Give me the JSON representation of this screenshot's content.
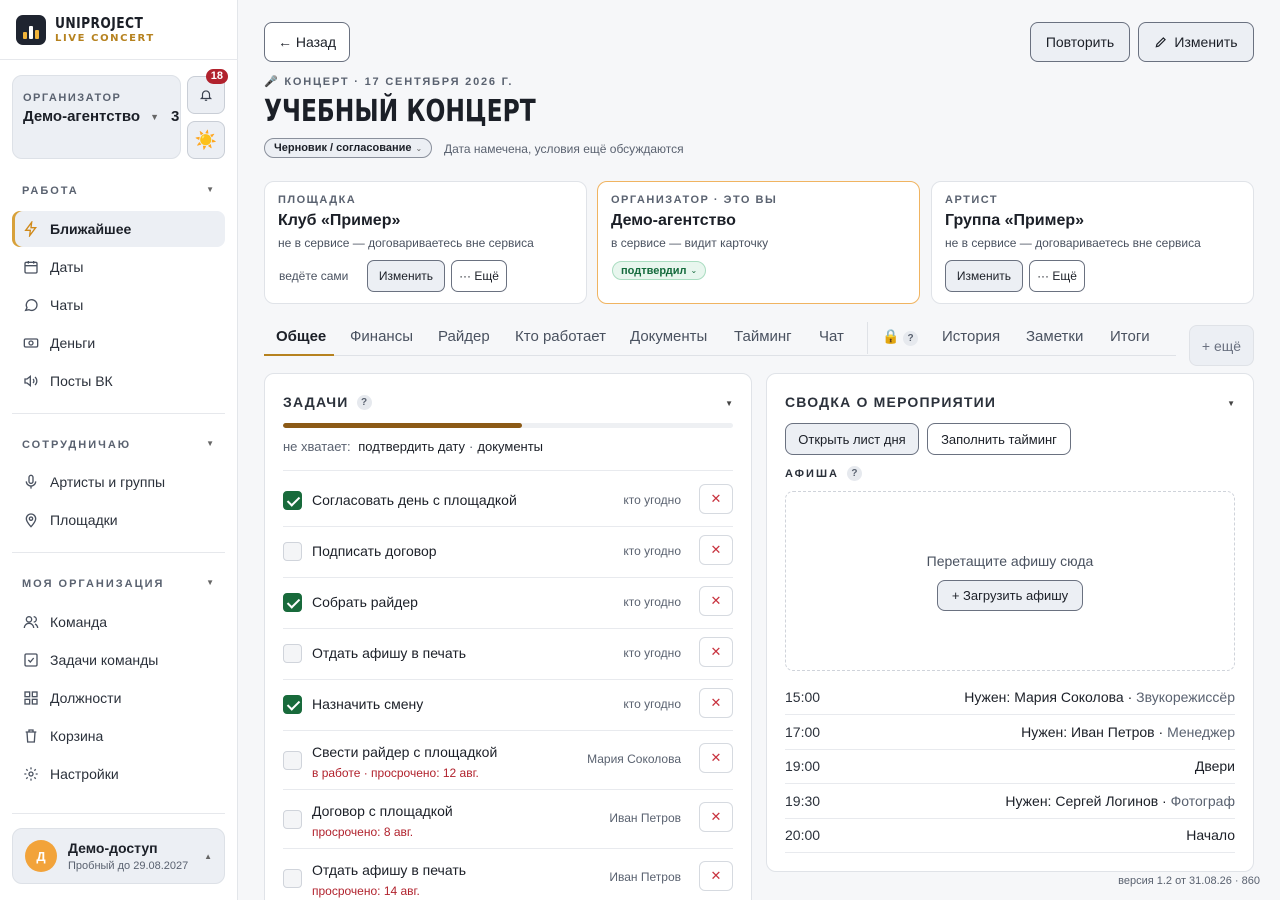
{
  "app": {
    "brand_line1": "UNIPROJECT",
    "brand_line2": "LIVE CONCERT"
  },
  "org": {
    "label": "ОРГАНИЗАТОР",
    "name": "Демо-агентство",
    "count": "3",
    "notifications": "18"
  },
  "sidebar": {
    "sections": [
      {
        "title": "РАБОТА",
        "items": [
          "Ближайшее",
          "Даты",
          "Чаты",
          "Деньги",
          "Посты ВК"
        ]
      },
      {
        "title": "СОТРУДНИЧАЮ",
        "items": [
          "Артисты и группы",
          "Площадки"
        ]
      },
      {
        "title": "МОЯ ОРГАНИЗАЦИЯ",
        "items": [
          "Команда",
          "Задачи команды",
          "Должности",
          "Корзина",
          "Настройки"
        ]
      }
    ],
    "active_item": "Ближайшее"
  },
  "user": {
    "initial": "Д",
    "name": "Демо-доступ",
    "trial": "Пробный до 29.08.2027"
  },
  "header": {
    "back": "← Назад",
    "repeat": "Повторить",
    "edit": "Изменить",
    "eyebrow": "🎤 КОНЦЕРТ · 17 СЕНТЯБРЯ 2026 Г.",
    "title": "УЧЕБНЫЙ КОНЦЕРТ",
    "status": "Черновик / согласование",
    "status_note": "Дата намечена, условия ещё обсуждаются"
  },
  "parties": {
    "venue": {
      "label": "ПЛОЩАДКА",
      "name": "Клуб «Пример»",
      "desc": "не в сервисе — договариваетесь вне сервиса",
      "self": "ведёте сами",
      "edit": "Изменить",
      "more": "··· Ещё"
    },
    "organizer": {
      "label": "ОРГАНИЗАТОР · ЭТО ВЫ",
      "name": "Демо-агентство",
      "desc": "в сервисе — видит карточку",
      "status": "подтвердил"
    },
    "artist": {
      "label": "АРТИСТ",
      "name": "Группа «Пример»",
      "desc": "не в сервисе — договариваетесь вне сервиса",
      "edit": "Изменить",
      "more": "··· Ещё"
    }
  },
  "tabs": [
    "Общее",
    "Финансы",
    "Райдер",
    "Кто работает",
    "Документы",
    "Тайминг",
    "Чат",
    "История",
    "Заметки",
    "Итоги"
  ],
  "tabs_more": "+ ещё",
  "tasks": {
    "title": "ЗАДАЧИ",
    "progress": 0.53,
    "missing_label": "не хватает:",
    "missing": [
      "подтвердить дату",
      "документы"
    ],
    "items": [
      {
        "name": "Согласовать день с площадкой",
        "who": "кто угодно",
        "done": true,
        "sub": ""
      },
      {
        "name": "Подписать договор",
        "who": "кто угодно",
        "done": false,
        "sub": ""
      },
      {
        "name": "Собрать райдер",
        "who": "кто угодно",
        "done": true,
        "sub": ""
      },
      {
        "name": "Отдать афишу в печать",
        "who": "кто угодно",
        "done": false,
        "sub": ""
      },
      {
        "name": "Назначить смену",
        "who": "кто угодно",
        "done": true,
        "sub": ""
      },
      {
        "name": "Свести райдер с площадкой",
        "who": "Мария Соколова",
        "done": false,
        "sub": "в работе · просрочено: 12 авг."
      },
      {
        "name": "Договор с площадкой",
        "who": "Иван Петров",
        "done": false,
        "sub": "просрочено: 8 авг."
      },
      {
        "name": "Отдать афишу в печать",
        "who": "Иван Петров",
        "done": false,
        "sub": "просрочено: 14 авг."
      }
    ]
  },
  "summary": {
    "title": "СВОДКА О МЕРОПРИЯТИИ",
    "open_day": "Открыть лист дня",
    "fill_timing": "Заполнить тайминг",
    "poster_label": "АФИША",
    "drop_hint": "Перетащите афишу сюда",
    "upload": "+ Загрузить афишу",
    "timeline": [
      {
        "time": "15:00",
        "event": "Нужен: Мария Соколова",
        "role": "Звукорежиссёр"
      },
      {
        "time": "17:00",
        "event": "Нужен: Иван Петров",
        "role": "Менеджер"
      },
      {
        "time": "19:00",
        "event": "Двери",
        "role": ""
      },
      {
        "time": "19:30",
        "event": "Нужен: Сергей Логинов",
        "role": "Фотограф"
      },
      {
        "time": "20:00",
        "event": "Начало",
        "role": ""
      }
    ]
  },
  "version": "версия 1.2 от 31.08.26 · 860"
}
